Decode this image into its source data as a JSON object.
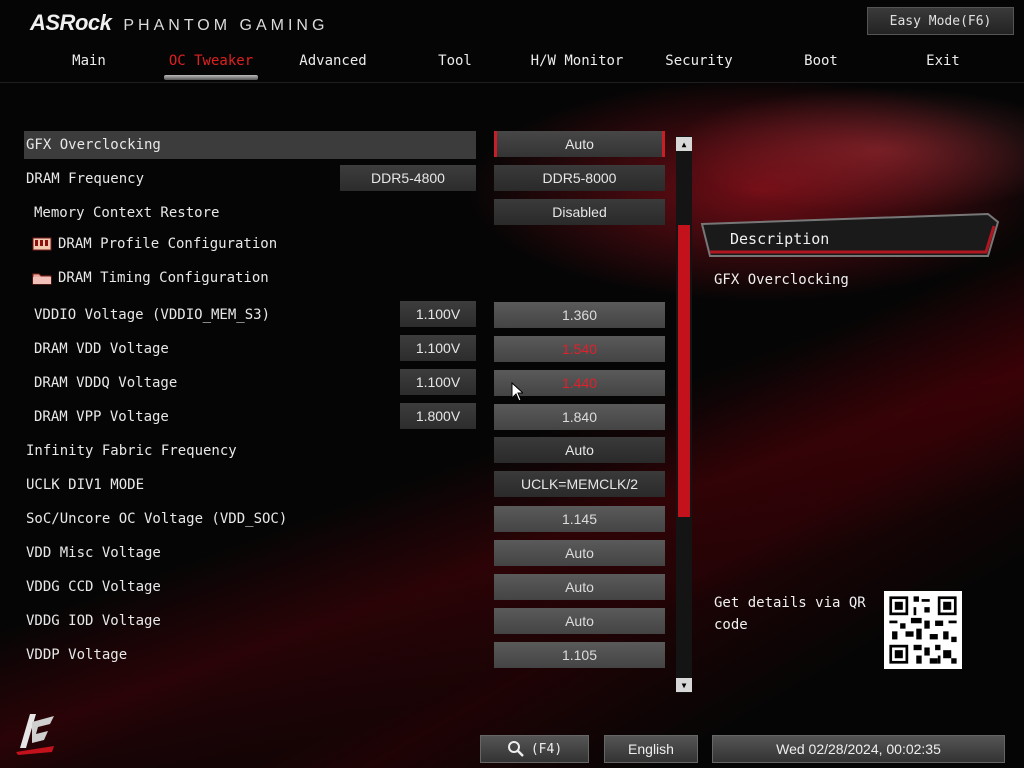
{
  "brand": {
    "name": "ASRock",
    "sub": "PHANTOM GAMING"
  },
  "easy_mode_label": "Easy Mode(F6)",
  "nav": {
    "tabs": [
      {
        "label": "Main"
      },
      {
        "label": "OC Tweaker"
      },
      {
        "label": "Advanced"
      },
      {
        "label": "Tool"
      },
      {
        "label": "H/W Monitor"
      },
      {
        "label": "Security"
      },
      {
        "label": "Boot"
      },
      {
        "label": "Exit"
      }
    ],
    "active": "OC Tweaker"
  },
  "settings": [
    {
      "label": "GFX Overclocking",
      "value": "Auto"
    },
    {
      "label": "DRAM Frequency",
      "current": "DDR5-4800",
      "value": "DDR5-8000"
    },
    {
      "label": "Memory Context Restore",
      "value": "Disabled"
    },
    {
      "label": "DRAM Profile Configuration",
      "icon": "memory-module-icon"
    },
    {
      "label": "DRAM Timing Configuration",
      "icon": "folder-icon"
    },
    {
      "label": "VDDIO Voltage (VDDIO_MEM_S3)",
      "current": "1.100V",
      "value": "1.360"
    },
    {
      "label": "DRAM VDD Voltage",
      "current": "1.100V",
      "value": "1.540"
    },
    {
      "label": "DRAM VDDQ Voltage",
      "current": "1.100V",
      "value": "1.440"
    },
    {
      "label": "DRAM VPP Voltage",
      "current": "1.800V",
      "value": "1.840"
    },
    {
      "label": "Infinity Fabric Frequency",
      "value": "Auto"
    },
    {
      "label": "UCLK DIV1 MODE",
      "value": "UCLK=MEMCLK/2"
    },
    {
      "label": "SoC/Uncore OC Voltage (VDD_SOC)",
      "value": "1.145"
    },
    {
      "label": "VDD Misc Voltage",
      "value": "Auto"
    },
    {
      "label": "VDDG CCD Voltage",
      "value": "Auto"
    },
    {
      "label": "VDDG IOD Voltage",
      "value": "Auto"
    },
    {
      "label": "VDDP Voltage",
      "value": "1.105"
    }
  ],
  "description": {
    "title": "Description",
    "text": "GFX Overclocking"
  },
  "qr_text": "Get details via QR code",
  "footer": {
    "search_label": "(F4)",
    "language": "English",
    "datetime": "Wed 02/28/2024, 00:02:35"
  },
  "colors": {
    "accent": "#c81e28",
    "warning_value": "#e0202a",
    "selected_row": "#3c3c3c"
  }
}
